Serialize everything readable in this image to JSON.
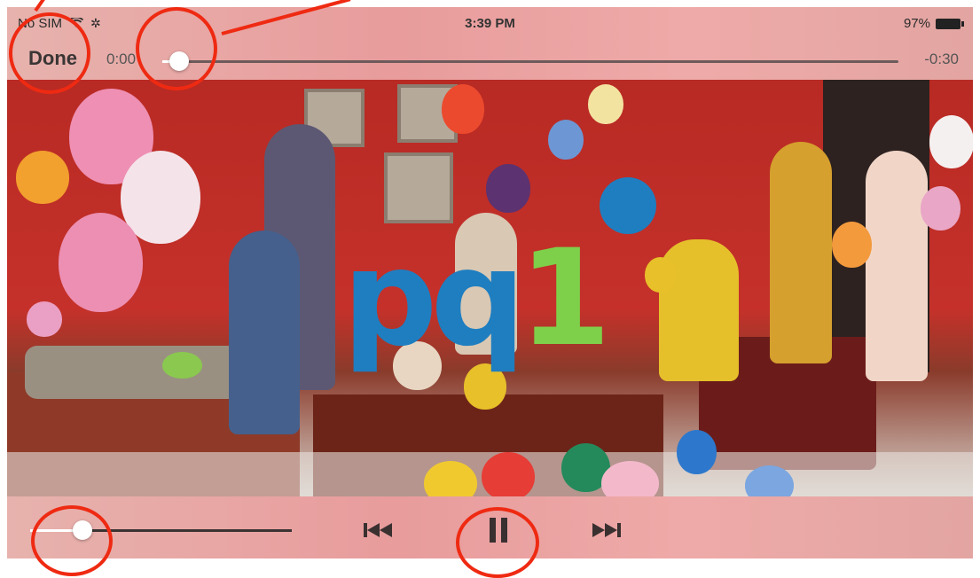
{
  "status_bar": {
    "carrier": "No SIM",
    "wifi_icon": "wifi-icon",
    "loading_icon": "activity-spinner-icon",
    "time": "3:39 PM",
    "battery_percent": "97%",
    "battery_level": 0.97
  },
  "player": {
    "done_label": "Done",
    "elapsed": "0:00",
    "remaining": "-0:30",
    "scrub_progress": 0.0,
    "volume_level": 0.2
  },
  "video": {
    "logo_text_left": "pq",
    "logo_text_right": "1",
    "logo_colors": {
      "blue": "#1f7ec0",
      "green": "#7ed04a"
    }
  },
  "controls": {
    "previous_icon": "skip-back-icon",
    "pause_icon": "pause-icon",
    "next_icon": "skip-forward-icon"
  },
  "annotation_color": "#ef2a12"
}
